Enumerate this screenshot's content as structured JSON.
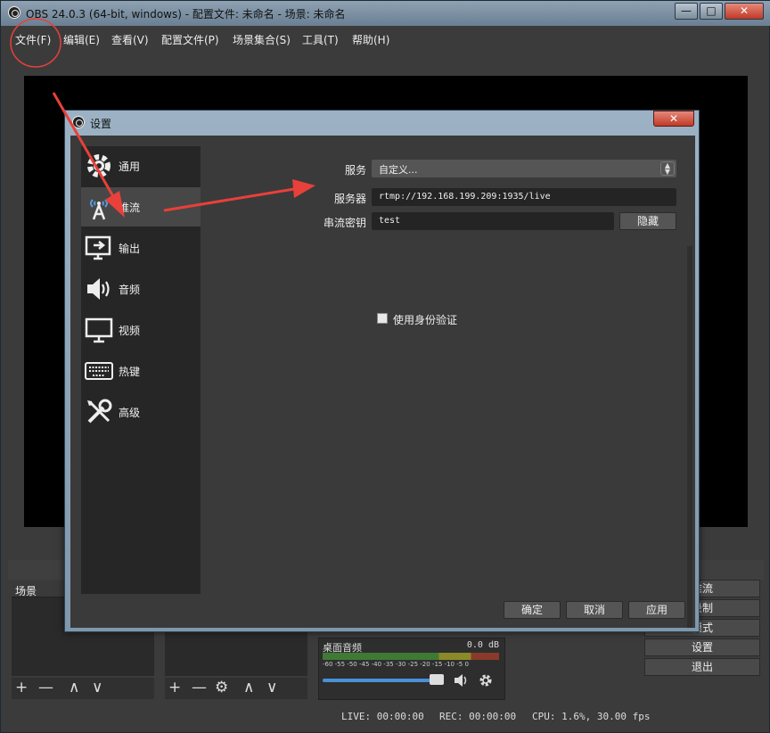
{
  "window": {
    "title": "OBS 24.0.3 (64-bit, windows) - 配置文件: 未命名 - 场景: 未命名",
    "min_glyph": "—",
    "max_glyph": "□",
    "close_glyph": "✕"
  },
  "menu": {
    "items": [
      "文件(F)",
      "编辑(E)",
      "查看(V)",
      "配置文件(P)",
      "场景集合(S)",
      "工具(T)",
      "帮助(H)"
    ]
  },
  "docks": {
    "scenes_title": "场景",
    "mixer": {
      "name": "桌面音频",
      "db": "0.0 dB",
      "scale": "-60 -55 -50 -45 -40 -35 -30 -25 -20 -15 -10 -5 0"
    },
    "controls": [
      "推流",
      "录制",
      "模式",
      "设置",
      "退出"
    ],
    "tool_glyphs": {
      "add": "+",
      "remove": "—",
      "up": "∧",
      "down": "∨",
      "gear": "⚙"
    }
  },
  "status": {
    "live": "LIVE: 00:00:00",
    "rec": "REC: 00:00:00",
    "cpu": "CPU: 1.6%, 30.00 fps"
  },
  "dialog": {
    "title": "设置",
    "close_glyph": "✕",
    "sidebar": [
      {
        "label": "通用",
        "icon": "gear-icon"
      },
      {
        "label": "推流",
        "icon": "broadcast-icon",
        "active": true
      },
      {
        "label": "输出",
        "icon": "output-icon"
      },
      {
        "label": "音频",
        "icon": "speaker-icon"
      },
      {
        "label": "视频",
        "icon": "monitor-icon"
      },
      {
        "label": "热键",
        "icon": "keyboard-icon"
      },
      {
        "label": "高级",
        "icon": "tools-icon"
      }
    ],
    "stream": {
      "service_label": "服务",
      "service_value": "自定义...",
      "server_label": "服务器",
      "server_value": "rtmp://192.168.199.209:1935/live",
      "key_label": "串流密钥",
      "key_value": "test",
      "hide_button": "隐藏",
      "auth_label": "使用身份验证",
      "auth_checked": false
    },
    "buttons": {
      "ok": "确定",
      "cancel": "取消",
      "apply": "应用"
    }
  },
  "colors": {
    "annotation": "#e8403a",
    "accent": "#4a90d9",
    "panel": "#3a3a3a"
  }
}
